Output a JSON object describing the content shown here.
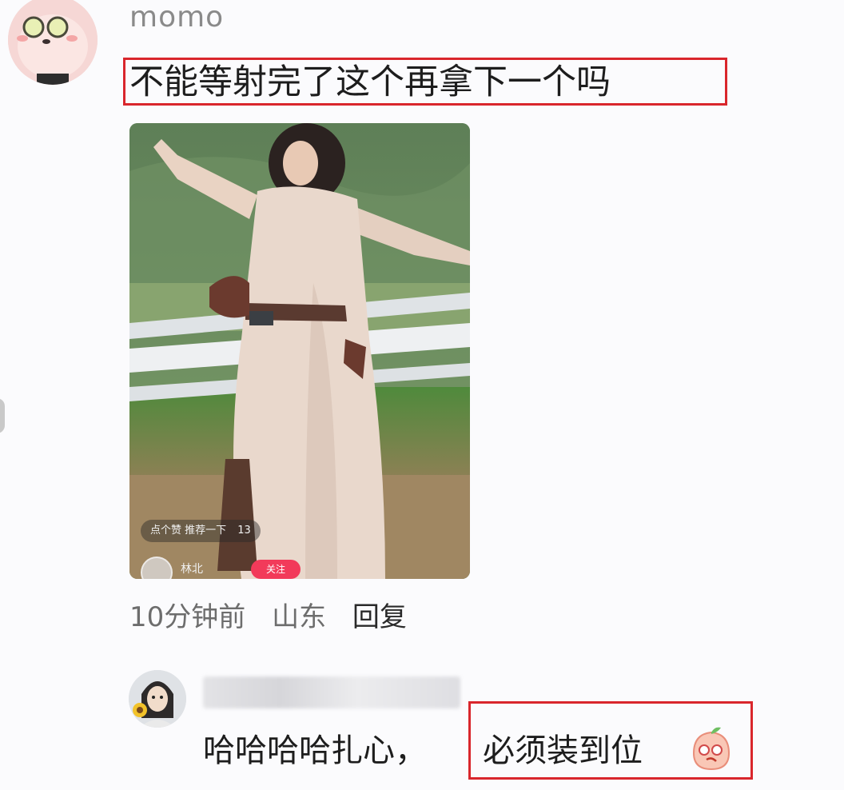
{
  "comment": {
    "username": "momo",
    "text": "不能等射完了这个再拿下一个吗",
    "photo": {
      "chip_text": "点个赞 推荐一下",
      "chip_count": "13",
      "author_name": "林北",
      "follow_label": "关注"
    },
    "meta": {
      "time": "10分钟前",
      "location": "山东",
      "reply_label": "回复"
    }
  },
  "reply": {
    "text_part1": "哈哈哈哈扎心，",
    "text_part2": "必须装到位",
    "emoji_icon": "peach-emoji-icon"
  },
  "colors": {
    "highlight_border": "#d9262c",
    "username": "#8a8a8a",
    "meta": "#6d6d6d",
    "follow_button": "#f23a5a"
  }
}
